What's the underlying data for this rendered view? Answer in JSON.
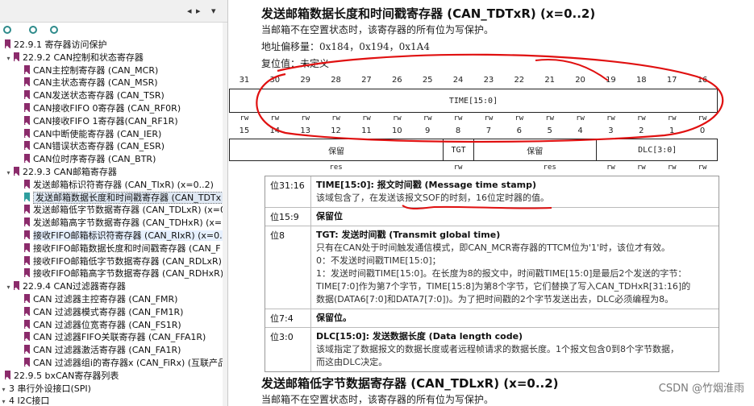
{
  "left_panel": {
    "toolbar": {
      "close_glyph": "◂",
      "expand_glyph": "▸",
      "pin_glyph": "▾"
    },
    "tree": [
      {
        "label": "22.9.1 寄存器访问保护",
        "level": 1,
        "type": "bookmark"
      },
      {
        "label": "22.9.2 CAN控制和状态寄存器",
        "level": 1,
        "type": "folder"
      },
      {
        "label": "CAN主控制寄存器 (CAN_MCR)",
        "level": 2,
        "type": "bookmark"
      },
      {
        "label": "CAN主状态寄存器 (CAN_MSR)",
        "level": 2,
        "type": "bookmark"
      },
      {
        "label": "CAN发送状态寄存器 (CAN_TSR)",
        "level": 2,
        "type": "bookmark"
      },
      {
        "label": "CAN接收FIFO 0寄存器 (CAN_RF0R)",
        "level": 2,
        "type": "bookmark"
      },
      {
        "label": "CAN接收FIFO 1寄存器(CAN_RF1R)",
        "level": 2,
        "type": "bookmark"
      },
      {
        "label": "CAN中断使能寄存器 (CAN_IER)",
        "level": 2,
        "type": "bookmark"
      },
      {
        "label": "CAN错误状态寄存器 (CAN_ESR)",
        "level": 2,
        "type": "bookmark"
      },
      {
        "label": "CAN位时序寄存器 (CAN_BTR)",
        "level": 2,
        "type": "bookmark"
      },
      {
        "label": "22.9.3 CAN邮箱寄存器",
        "level": 1,
        "type": "folder"
      },
      {
        "label": "发送邮箱标识符寄存器 (CAN_TIxR) (x=0..2)",
        "level": 2,
        "type": "bookmark"
      },
      {
        "label": "发送邮箱数据长度和时间戳寄存器 (CAN_TDTx",
        "level": 2,
        "type": "bookmark",
        "selected": true
      },
      {
        "label": "发送邮箱低字节数据寄存器 (CAN_TDLxR) (x=0",
        "level": 2,
        "type": "bookmark"
      },
      {
        "label": "发送邮箱高字节数据寄存器 (CAN_TDHxR) (x=",
        "level": 2,
        "type": "bookmark"
      },
      {
        "label": "接收FIFO邮箱标识符寄存器 (CAN_RIxR) (x=0..1)",
        "level": 2,
        "type": "bookmark",
        "highlight": true
      },
      {
        "label": "接收FIFO邮箱数据长度和时间戳寄存器 (CAN_F",
        "level": 2,
        "type": "bookmark"
      },
      {
        "label": "接收FIFO邮箱低字节数据寄存器 (CAN_RDLxR)",
        "level": 2,
        "type": "bookmark"
      },
      {
        "label": "接收FIFO邮箱高字节数据寄存器 (CAN_RDHxR)",
        "level": 2,
        "type": "bookmark"
      },
      {
        "label": "22.9.4 CAN过滤器寄存器",
        "level": 1,
        "type": "folder"
      },
      {
        "label": "CAN 过滤器主控寄存器 (CAN_FMR)",
        "level": 2,
        "type": "bookmark"
      },
      {
        "label": "CAN 过滤器模式寄存器 (CAN_FM1R)",
        "level": 2,
        "type": "bookmark"
      },
      {
        "label": "CAN 过滤器位宽寄存器 (CAN_FS1R)",
        "level": 2,
        "type": "bookmark"
      },
      {
        "label": "CAN 过滤器FIFO关联寄存器 (CAN_FFA1R)",
        "level": 2,
        "type": "bookmark"
      },
      {
        "label": "CAN 过滤器激活寄存器 (CAN_FA1R)",
        "level": 2,
        "type": "bookmark"
      },
      {
        "label": "CAN 过滤器组i的寄存器x (CAN_FiRx) (互联产品",
        "level": 2,
        "type": "bookmark"
      },
      {
        "label": "22.9.5 bxCAN寄存器列表",
        "level": 1,
        "type": "bookmark"
      },
      {
        "label": "3 串行外设接口(SPI)",
        "level": 0,
        "type": "folder"
      },
      {
        "label": "4 I2C接口",
        "level": 0,
        "type": "folder"
      }
    ]
  },
  "doc": {
    "title": "发送邮箱数据长度和时间戳寄存器 (CAN_TDTxR) (x=0..2)",
    "note": "当邮箱不在空置状态时，该寄存器的所有位为写保护。",
    "offset": "地址偏移量：0x184，0x194，0x1A4",
    "reset": "复位值：未定义",
    "upper_bits": [
      "31",
      "30",
      "29",
      "28",
      "27",
      "26",
      "25",
      "24",
      "23",
      "22",
      "21",
      "20",
      "19",
      "18",
      "17",
      "16"
    ],
    "upper_field": "TIME[15:0]",
    "upper_access": [
      "rw",
      "rw",
      "rw",
      "rw",
      "rw",
      "rw",
      "rw",
      "rw",
      "rw",
      "rw",
      "rw",
      "rw",
      "rw",
      "rw",
      "rw",
      "rw"
    ],
    "lower_bits": [
      "15",
      "14",
      "13",
      "12",
      "11",
      "10",
      "9",
      "8",
      "7",
      "6",
      "5",
      "4",
      "3",
      "2",
      "1",
      "0"
    ],
    "lower_fields": [
      {
        "label": "保留",
        "span": 7
      },
      {
        "label": "TGT",
        "span": 1
      },
      {
        "label": "保留",
        "span": 4
      },
      {
        "label": "DLC[3:0]",
        "span": 4
      }
    ],
    "lower_access": [
      {
        "label": "res",
        "pos": 3
      },
      {
        "label": "rw",
        "pos": 7
      },
      {
        "label": "res",
        "pos": 10
      },
      {
        "label": "rw",
        "pos": 12
      },
      {
        "label": "rw",
        "pos": 13
      },
      {
        "label": "rw",
        "pos": 14
      },
      {
        "label": "rw",
        "pos": 15
      }
    ],
    "desc_rows": [
      {
        "bits": "位31:16",
        "title": "TIME[15:0]: 报文时间戳 (Message time stamp)",
        "lines": [
          "该域包含了，在发送该报文SOF的时刻，16位定时器的值。"
        ]
      },
      {
        "bits": "位15:9",
        "title": "保留位",
        "lines": []
      },
      {
        "bits": "位8",
        "title": "TGT: 发送时间戳 (Transmit global time)",
        "lines": [
          "只有在CAN处于时间触发通信模式，即CAN_MCR寄存器的TTCM位为'1'时，该位才有效。",
          "0：不发送时间戳TIME[15:0]；",
          "1：发送时间戳TIME[15:0]。在长度为8的报文中，时间戳TIME[15:0]是最后2个发送的字节：",
          "TIME[7:0]作为第7个字节，TIME[15:8]为第8个字节，它们替换了写入CAN_TDHxR[31:16]的",
          "数据(DATA6[7:0]和DATA7[7:0])。为了把时间戳的2个字节发送出去，DLC必须编程为8。"
        ]
      },
      {
        "bits": "位7:4",
        "title": "保留位。",
        "lines": []
      },
      {
        "bits": "位3:0",
        "title": "DLC[15:0]: 发送数据长度 (Data length code)",
        "lines": [
          "该域指定了数据报文的数据长度或者远程帧请求的数据长度。1个报文包含0到8个字节数据，",
          "而这由DLC决定。"
        ]
      }
    ],
    "next_title": "发送邮箱低字节数据寄存器 (CAN_TDLxR) (x=0..2)",
    "next_note": "当邮箱不在空置状态时，该寄存器的所有位为写保护。"
  },
  "watermark": "CSDN @竹烟淮雨",
  "colors": {
    "annotation_red": "#e01010",
    "bookmark": "#8b2b6b",
    "bookmark_teal": "#2e9e9e"
  }
}
